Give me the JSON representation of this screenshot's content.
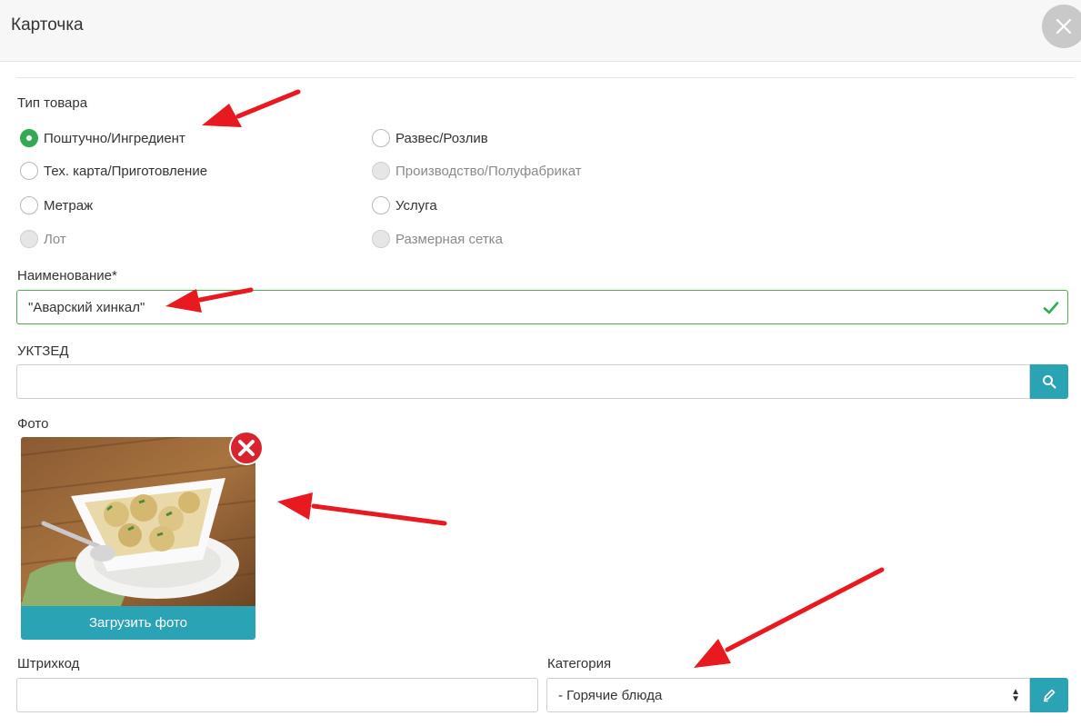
{
  "header": {
    "title": "Карточка",
    "close_icon": "close-icon"
  },
  "product_type": {
    "label": "Тип товара",
    "options": [
      {
        "label": "Поштучно/Ингредиент",
        "state": "checked"
      },
      {
        "label": "Развес/Розлив",
        "state": "unchecked"
      },
      {
        "label": "Тех. карта/Приготовление",
        "state": "unchecked"
      },
      {
        "label": "Производство/Полуфабрикат",
        "state": "disabled"
      },
      {
        "label": "Метраж",
        "state": "unchecked"
      },
      {
        "label": "Услуга",
        "state": "unchecked"
      },
      {
        "label": "Лот",
        "state": "disabled"
      },
      {
        "label": "Размерная сетка",
        "state": "disabled"
      }
    ]
  },
  "name": {
    "label": "Наименование*",
    "value": "\"Аварский хинкал\"",
    "status_icon": "check-icon"
  },
  "uktzed": {
    "label": "УКТЗЕД",
    "value": "",
    "search_icon": "search-icon"
  },
  "photo": {
    "label": "Фото",
    "upload_label": "Загрузить фото",
    "remove_icon": "remove-icon"
  },
  "barcode": {
    "label": "Штрихкод",
    "value": ""
  },
  "category": {
    "label": "Категория",
    "value": "- Горячие блюда",
    "edit_icon": "pencil-icon"
  },
  "colors": {
    "accent": "#2aa3b5",
    "success": "#35a853",
    "annotation": "#e8191f"
  }
}
